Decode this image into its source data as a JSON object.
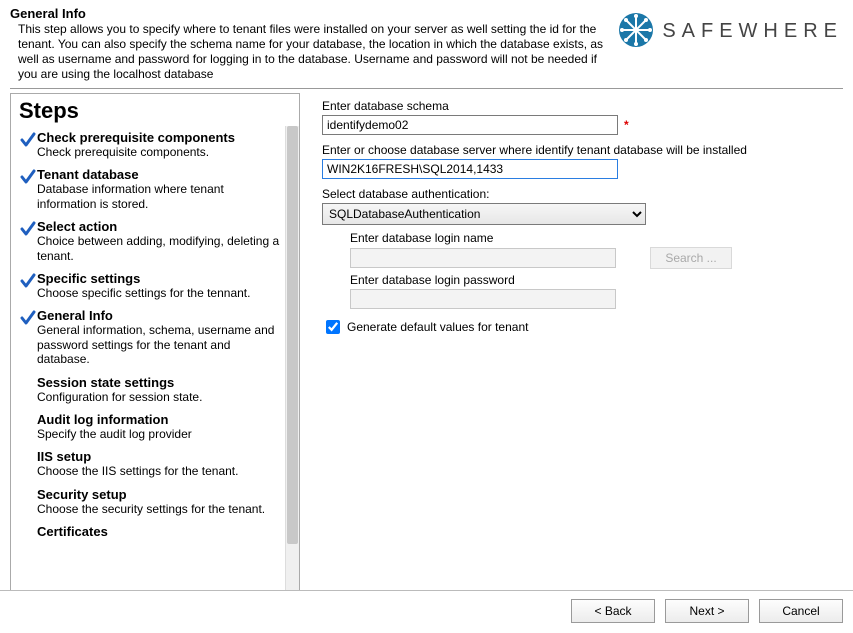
{
  "header": {
    "title": "General Info",
    "description": "This step allows you to specify where to tenant files were installed on your server as well setting the id for the tenant. You can also specify the schema name for your database, the location in which the database exists, as well as username and password for logging in to the database. Username and password will not be needed if you are using the localhost database"
  },
  "brand": {
    "name": "SAFEWHERE"
  },
  "steps": {
    "heading": "Steps",
    "items": [
      {
        "title": "Check prerequisite components",
        "desc": "Check prerequisite components.",
        "checked": true
      },
      {
        "title": "Tenant database",
        "desc": "Database information where tenant information is stored.",
        "checked": true
      },
      {
        "title": "Select action",
        "desc": "Choice between adding, modifying, deleting a tenant.",
        "checked": true
      },
      {
        "title": "Specific settings",
        "desc": "Choose specific settings for the tennant.",
        "checked": true
      },
      {
        "title": "General Info",
        "desc": "General information, schema, username and password settings for the tenant and database.",
        "checked": true
      },
      {
        "title": "Session state settings",
        "desc": "Configuration for session state.",
        "checked": false
      },
      {
        "title": "Audit log information",
        "desc": "Specify the audit log provider",
        "checked": false
      },
      {
        "title": "IIS setup",
        "desc": "Choose the IIS settings for the tenant.",
        "checked": false
      },
      {
        "title": "Security setup",
        "desc": "Choose the security settings for the tenant.",
        "checked": false
      },
      {
        "title": "Certificates",
        "desc": "",
        "checked": false
      }
    ]
  },
  "form": {
    "schema_label": "Enter database schema",
    "schema_value": "identifydemo02",
    "server_label": "Enter or choose database server where identify tenant database will be installed",
    "server_value": "WIN2K16FRESH\\SQL2014,1433",
    "auth_label": "Select database authentication:",
    "auth_value": "SQLDatabaseAuthentication",
    "login_name_label": "Enter database login name",
    "login_name_value": "",
    "login_pass_label": "Enter database login password",
    "login_pass_value": "",
    "search_label": "Search ...",
    "generate_checked": true,
    "generate_label": "Generate default values for tenant"
  },
  "footer": {
    "back": "< Back",
    "next": "Next >",
    "cancel": "Cancel"
  },
  "colors": {
    "check": "#1f5fbf",
    "brand_bg": "#1b77a8"
  }
}
